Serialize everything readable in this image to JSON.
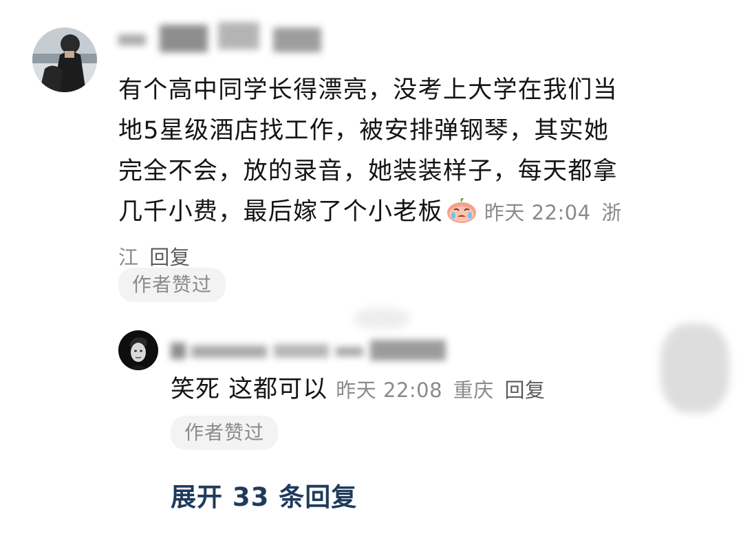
{
  "comment": {
    "text": "有个高中同学长得漂亮，没考上大学在我们当地5星级酒店找工作，被安排弹钢琴，其实她完全不会，放的录音，她装装样子，每天都拿几千小费，最后嫁了个小老板",
    "emoji": "crying-emoji",
    "time": "昨天 22:04",
    "location": "浙江",
    "reply_label": "回复",
    "author_liked_label": "作者赞过"
  },
  "reply": {
    "text": "笑死 这都可以",
    "time": "昨天 22:08",
    "location": "重庆",
    "reply_label": "回复",
    "author_liked_label": "作者赞过"
  },
  "expand_label": "展开 33 条回复",
  "colors": {
    "text": "#141414",
    "meta": "#8a8a8a",
    "pill_bg": "#f3f3f3",
    "expand_link": "#1f3b5c"
  }
}
